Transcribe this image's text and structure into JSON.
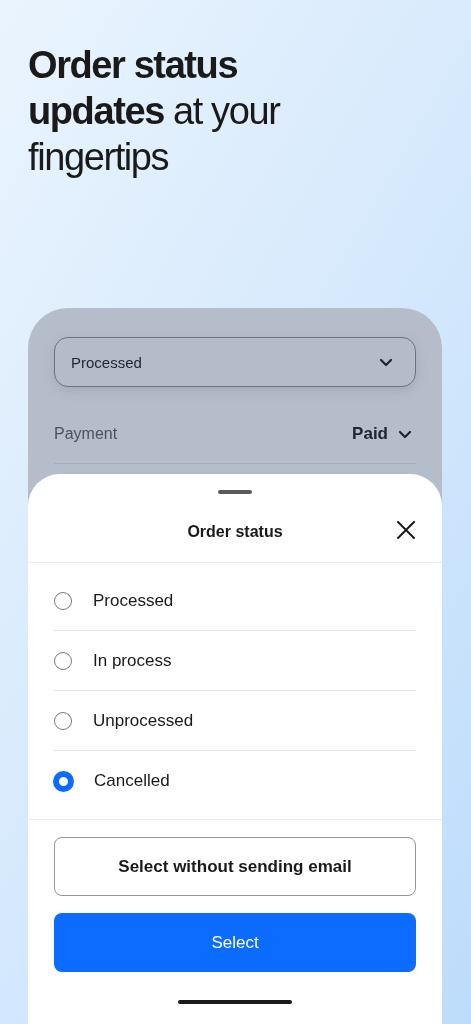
{
  "headline": "**Order status updates** at your fingertips",
  "status_dropdown": {
    "value": "Processed"
  },
  "payment": {
    "label": "Payment",
    "value": "Paid"
  },
  "sheet": {
    "title": "Order status",
    "options": [
      {
        "label": "Processed",
        "selected": false
      },
      {
        "label": "In process",
        "selected": false
      },
      {
        "label": "Unprocessed",
        "selected": false
      },
      {
        "label": "Cancelled",
        "selected": true
      }
    ],
    "buttons": [
      {
        "label": "Select without sending email",
        "kind": "secondary"
      },
      {
        "label": "Select",
        "kind": "primary"
      }
    ]
  }
}
